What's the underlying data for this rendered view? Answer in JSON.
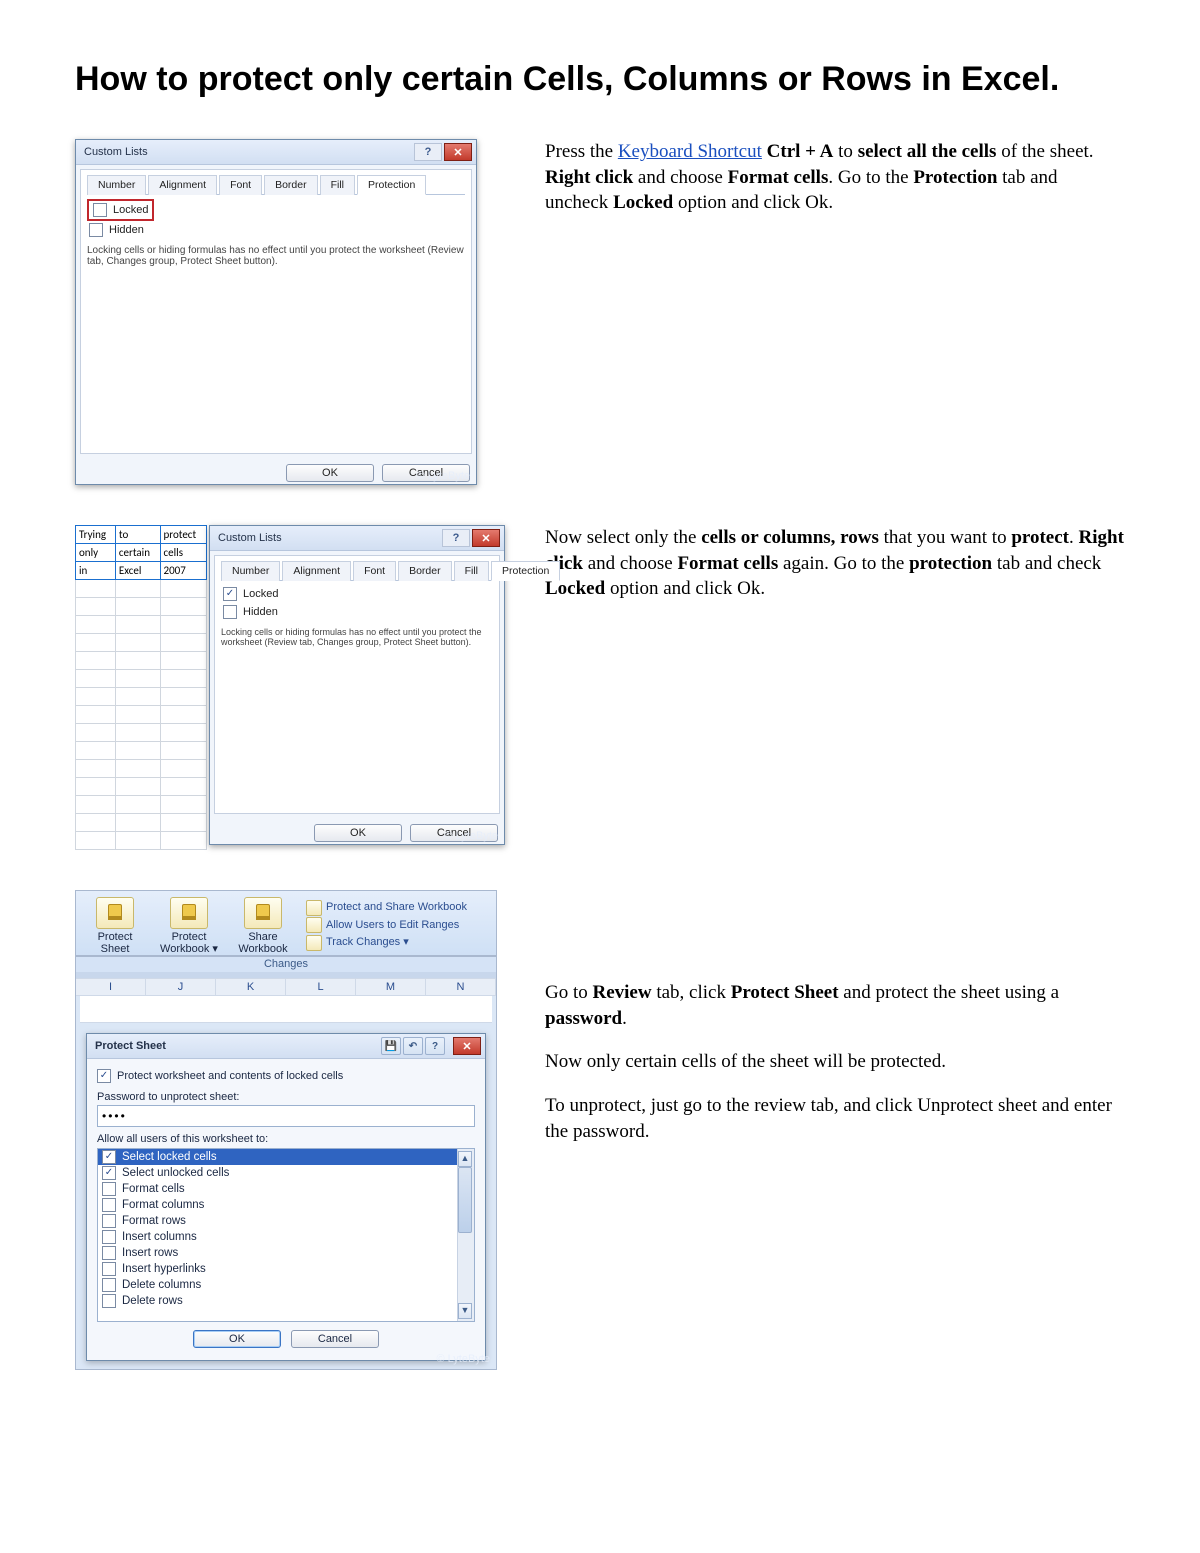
{
  "title": "How to protect only certain Cells, Columns or Rows in Excel.",
  "step1": {
    "link": "Keyboard Shortcut",
    "t1a": "Press the ",
    "t1b": " Ctrl + A",
    "t1c": " to ",
    "t1d": "select all the cells",
    "t1e": " of the sheet. ",
    "t1f": "Right click",
    "t1g": " and choose ",
    "t1h": "Format cells",
    "t1i": ". Go to the ",
    "t1j": "Protection",
    "t1k": " tab and uncheck ",
    "t1l": "Locked",
    "t1m": " option and click Ok."
  },
  "step2": {
    "t2a": "Now select only the ",
    "t2b": "cells or columns, rows",
    "t2c": " that you want to ",
    "t2d": "protect",
    "t2e": ". ",
    "t2f": "Right click",
    "t2g": " and choose ",
    "t2h": "Format cells",
    "t2i": " again. Go to the ",
    "t2j": "protection",
    "t2k": " tab and check ",
    "t2l": "Locked",
    "t2m": " option and click Ok."
  },
  "step3": {
    "p1a": "Go to ",
    "p1b": "Review",
    "p1c": " tab, click ",
    "p1d": "Protect Sheet",
    "p1e": " and protect the sheet using a ",
    "p1f": "password",
    "p1g": ".",
    "p2": "Now only certain cells of the sheet will be protected.",
    "p3": "To unprotect, just go to the review tab, and click Unprotect sheet and enter the password."
  },
  "dialog": {
    "title": "Custom Lists",
    "tabs": {
      "number": "Number",
      "alignment": "Alignment",
      "font": "Font",
      "border": "Border",
      "fill": "Fill",
      "protection": "Protection"
    },
    "locked": "Locked",
    "hidden": "Hidden",
    "note": "Locking cells or hiding formulas has no effect until you protect the worksheet (Review tab, Changes group, Protect Sheet button).",
    "ok": "OK",
    "cancel": "Cancel",
    "help": "?",
    "close": "✕",
    "watermark": "© LyteByte"
  },
  "sheet": {
    "r1": [
      "Trying",
      "to",
      "protect"
    ],
    "r2": [
      "only",
      "certain",
      "cells"
    ],
    "r3": [
      "in",
      "Excel",
      "2007"
    ]
  },
  "ribbon": {
    "protectSheet": "Protect Sheet",
    "protectWorkbook": "Protect Workbook ▾",
    "shareWorkbook": "Share Workbook",
    "side1": "Protect and Share Workbook",
    "side2": "Allow Users to Edit Ranges",
    "side3": "Track Changes ▾",
    "group": "Changes",
    "cols": [
      "I",
      "J",
      "K",
      "L",
      "M",
      "N"
    ]
  },
  "protectSheet": {
    "title": "Protect Sheet",
    "qatSave": "💾",
    "qatUndo": "↶",
    "qatHelp": "?",
    "close": "✕",
    "chk1": "Protect worksheet and contents of locked cells",
    "pwLabel": "Password to unprotect sheet:",
    "pwValue": "••••",
    "allowLabel": "Allow all users of this worksheet to:",
    "items": [
      "Select locked cells",
      "Select unlocked cells",
      "Format cells",
      "Format columns",
      "Format rows",
      "Insert columns",
      "Insert rows",
      "Insert hyperlinks",
      "Delete columns",
      "Delete rows"
    ],
    "ok": "OK",
    "cancel": "Cancel"
  }
}
